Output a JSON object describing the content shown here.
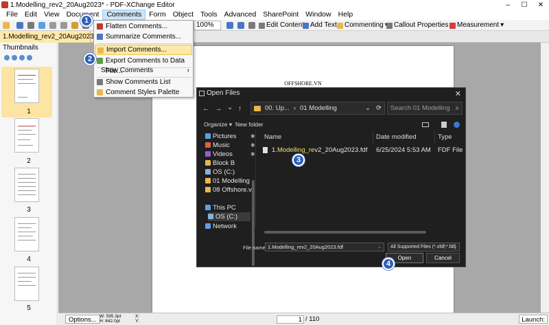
{
  "window": {
    "title": "1.Modelling_rev2_20Aug2023* - PDF-XChange Editor",
    "minimize": "–",
    "maximize": "☐",
    "close": "✕"
  },
  "menubar": [
    "File",
    "Edit",
    "View",
    "Document",
    "Comments",
    "Form",
    "Object",
    "Tools",
    "Advanced",
    "SharePoint",
    "Window",
    "Help"
  ],
  "toolbar": {
    "zoom": "100%",
    "edit_content": "Edit Content",
    "add_text": "Add Text",
    "commenting": "Commenting",
    "callout_properties": "Callout Properties",
    "measurement": "Measurement"
  },
  "document_tab": "1.Modelling_rev2_20Aug2023 *",
  "thumbnails": {
    "header": "Thumbnails",
    "pages": [
      "1",
      "2",
      "3",
      "4",
      "5"
    ]
  },
  "page_header": "OFFSHORE.VN",
  "comments_menu": {
    "items": [
      {
        "label": "Flatten Comments..."
      },
      {
        "label": "Summarize Comments..."
      },
      {
        "label": "Import Comments..."
      },
      {
        "label": "Export Comments to Data File..."
      },
      {
        "label": "Show Comments"
      },
      {
        "label": "Show Comments List"
      },
      {
        "label": "Comment Styles Palette"
      }
    ]
  },
  "badges": [
    "1",
    "2",
    "3",
    "4"
  ],
  "open_dialog": {
    "title": "Open Files",
    "close": "✕",
    "nav": {
      "back": "←",
      "forward": "→",
      "dropdown": "⌄",
      "up": "↑",
      "refresh": "⟳"
    },
    "breadcrumb": [
      "00. Up...",
      "›",
      "01 Modelling"
    ],
    "search_placeholder": "Search 01 Modelling",
    "organize": "Organize ▾",
    "new_folder": "New folder",
    "nav_items": [
      {
        "label": "Pictures",
        "color": "#5aa0e8"
      },
      {
        "label": "Music",
        "color": "#e06040"
      },
      {
        "label": "Videos",
        "color": "#9060d0"
      },
      {
        "label": "Block B",
        "color": "#e8b84a"
      },
      {
        "label": "OS (C:)",
        "color": "#8ab0d8"
      },
      {
        "label": "01 Modelling",
        "color": "#e8b84a"
      },
      {
        "label": "08 Offshore.v",
        "color": "#e8b84a"
      },
      {
        "label": "This PC",
        "color": "#5aa0e8"
      },
      {
        "label": "OS (C:)",
        "color": "#8ab0d8"
      },
      {
        "label": "Network",
        "color": "#5aa0e8"
      }
    ],
    "columns": {
      "name": "Name",
      "date": "Date modified",
      "type": "Type"
    },
    "file": {
      "name_prefix": "1.",
      "name_highlight": "Modelling_re",
      "name_suffix": "v2_20Aug2023.fdf",
      "date": "6/25/2024 5:53 AM",
      "type": "FDF File"
    },
    "file_name_label": "File name:",
    "file_name_value": "1.Modelling_rev2_20Aug2023.fdf",
    "file_type_value": "All Supported Files (*.xfdf;*.fdf)",
    "open_label": "Open",
    "cancel_label": "Cancel"
  },
  "statusbar": {
    "options": "Options...",
    "width": "W: 595.3pt",
    "height": "H: 842.0pt",
    "x": "X:",
    "y": "Y:",
    "page_current": "1",
    "page_total": "/ 110",
    "launch": "Launch:"
  }
}
